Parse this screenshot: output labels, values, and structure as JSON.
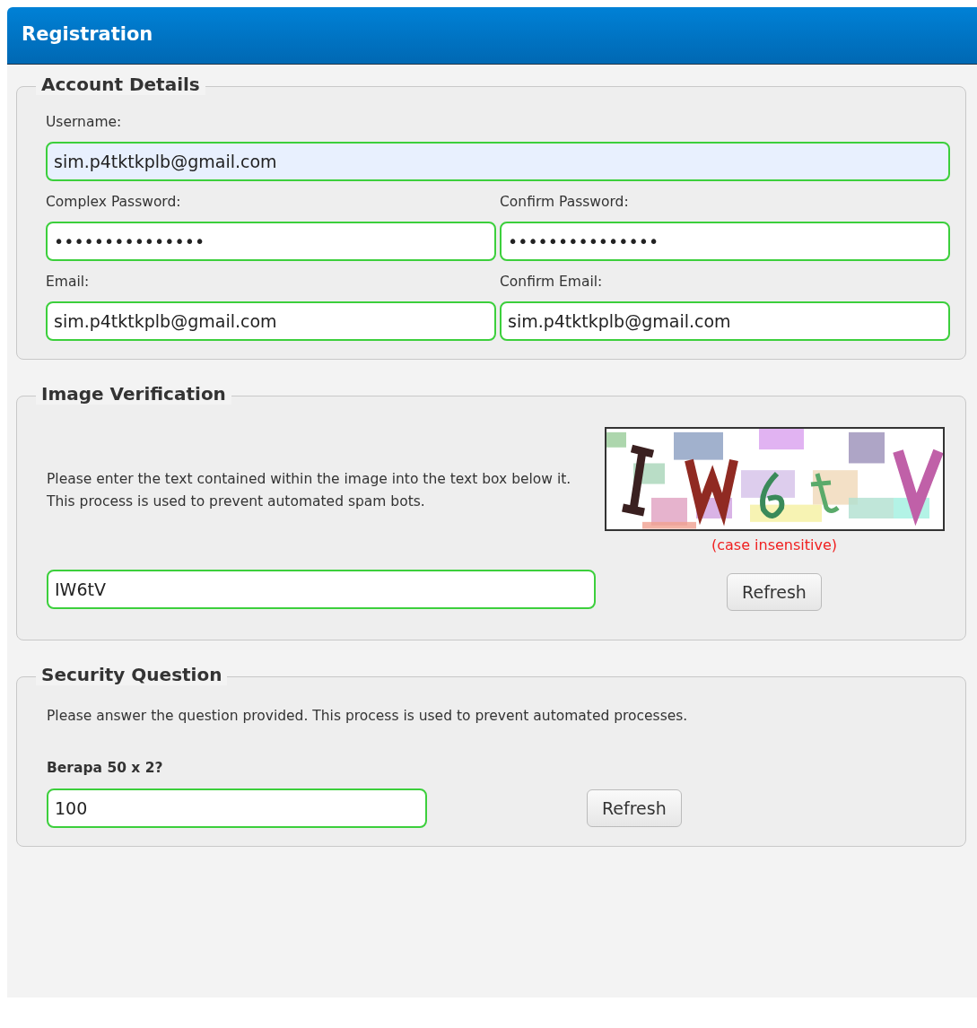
{
  "panel": {
    "title": "Registration"
  },
  "account_details": {
    "legend": "Account Details",
    "username": {
      "label": "Username:",
      "value": "sim.p4tktkplb@gmail.com",
      "autofilled": true
    },
    "password": {
      "label": "Complex Password:",
      "value": "•••••••••••••••",
      "autofilled": false
    },
    "confirm_password": {
      "label": "Confirm Password:",
      "value": "•••••••••••••••",
      "autofilled": false
    },
    "email": {
      "label": "Email:",
      "value": "sim.p4tktkplb@gmail.com",
      "autofilled": false
    },
    "confirm_email": {
      "label": "Confirm Email:",
      "value": "sim.p4tktkplb@gmail.com",
      "autofilled": false
    }
  },
  "image_verification": {
    "legend": "Image Verification",
    "instructions": "Please enter the text contained within the image into the text box below it. This process is used to prevent automated spam bots.",
    "note": "(case insensitive)",
    "answer": {
      "value": "IW6tV",
      "autofilled": false
    },
    "refresh_button": "Refresh"
  },
  "security_question": {
    "legend": "Security Question",
    "instructions": "Please answer the question provided. This process is used to prevent automated processes.",
    "question": "Berapa 50 x 2?",
    "answer": {
      "value": "100",
      "autofilled": false
    },
    "refresh_button": "Refresh"
  }
}
